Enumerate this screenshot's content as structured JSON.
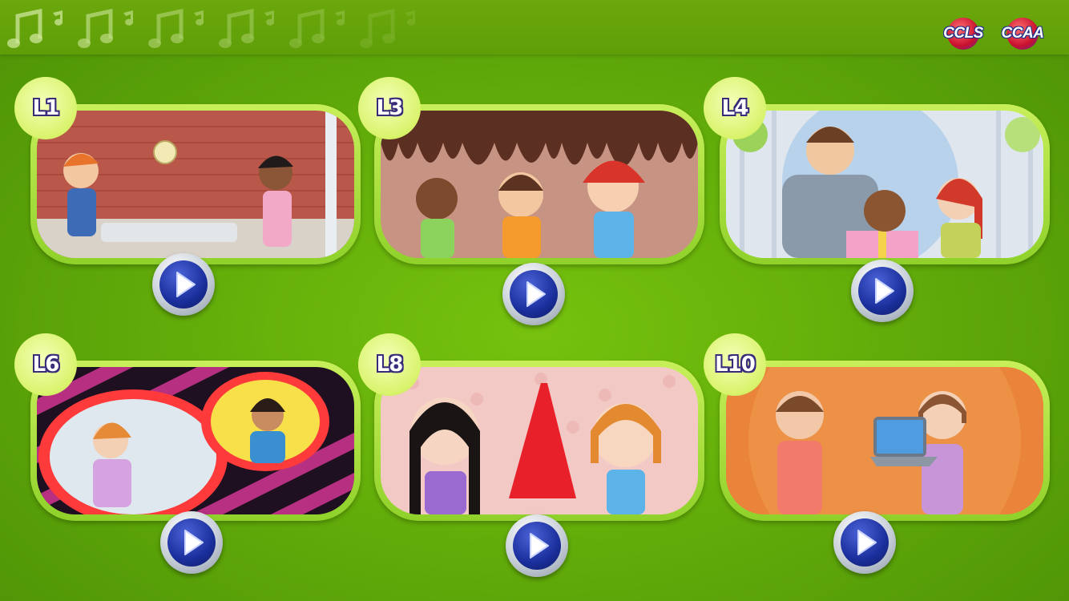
{
  "header": {
    "logos": [
      {
        "label": "CCLS"
      },
      {
        "label": "CCAA"
      }
    ]
  },
  "lessons": [
    {
      "badge": "L1",
      "scene": "volleyball-scene"
    },
    {
      "badge": "L3",
      "scene": "ice-cream-scene"
    },
    {
      "badge": "L4",
      "scene": "puppy-gift-scene"
    },
    {
      "badge": "L6",
      "scene": "phone-call-scene"
    },
    {
      "badge": "L8",
      "scene": "red-dress-scene"
    },
    {
      "badge": "L10",
      "scene": "laptop-scene"
    }
  ],
  "colors": {
    "background": "#6bb80c",
    "frame": "#a8e03c",
    "badge_text_outline": "#3a2a7a",
    "play_button": "#1b2f9c"
  }
}
